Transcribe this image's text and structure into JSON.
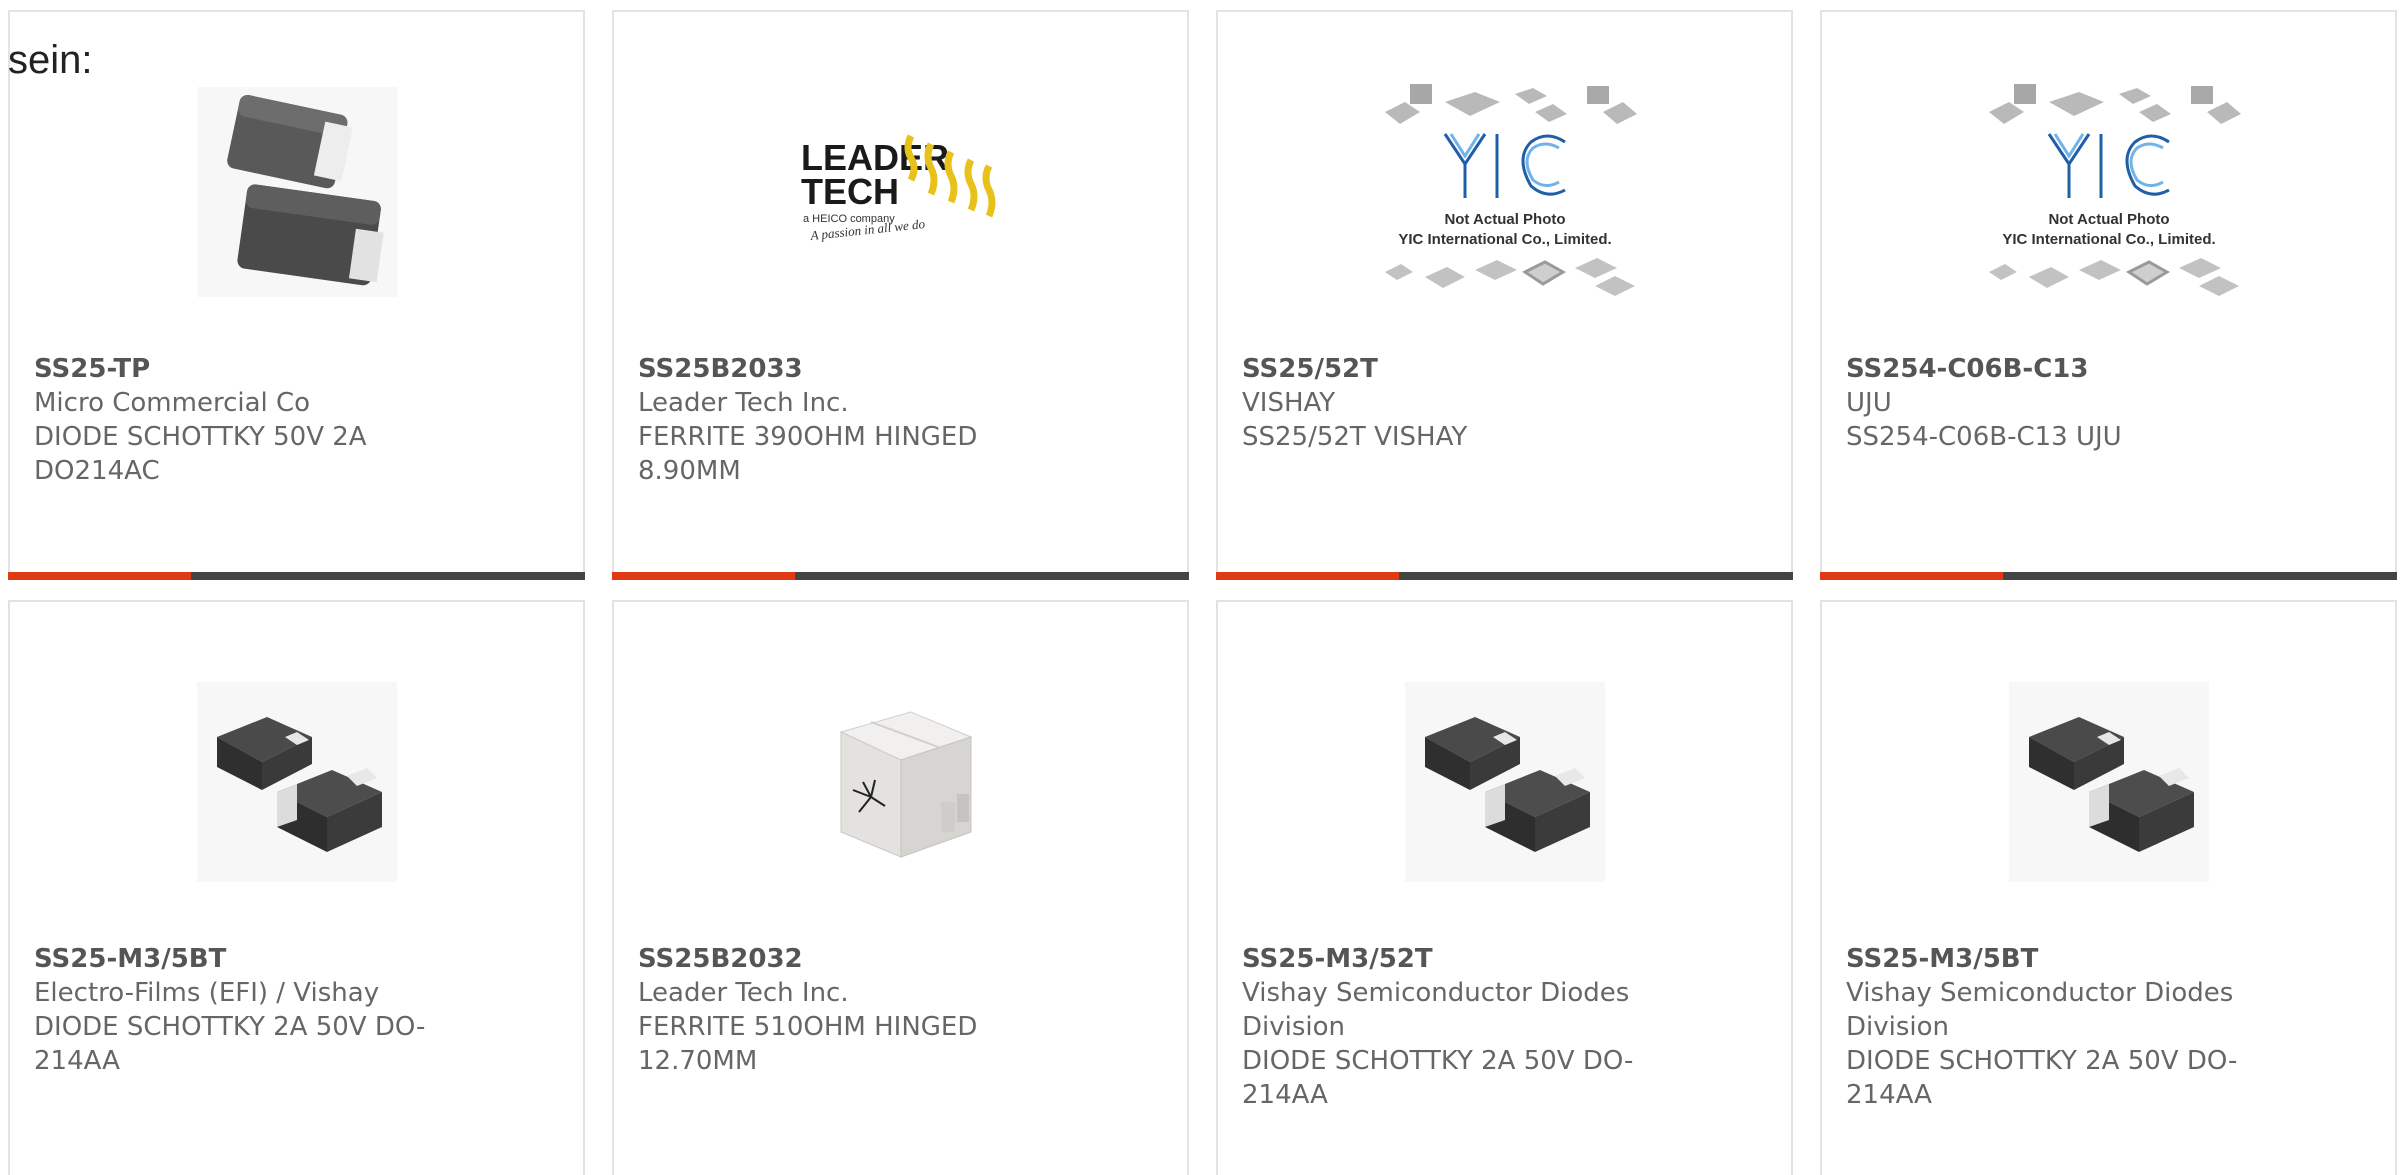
{
  "page": {
    "heading": "sein:"
  },
  "colors": {
    "accent": "#e03a12",
    "bar": "#444444",
    "border": "#e3e3e3",
    "text": "#666666"
  },
  "products": [
    {
      "part": "SS25-TP",
      "manufacturer": "Micro Commercial Co",
      "description": "DIODE SCHOTTKY 50V 2A DO214AC",
      "image": "smd-diode-do214-photo"
    },
    {
      "part": "SS25B2033",
      "manufacturer": "Leader Tech Inc.",
      "description": "FERRITE 390OHM HINGED 8.90MM",
      "image": "leader-tech-logo",
      "logo": {
        "line1": "LEADER",
        "line2": "TECH",
        "sub": "a HEICO company",
        "slogan": "A passion in all we do"
      }
    },
    {
      "part": "SS25/52T",
      "manufacturer": "VISHAY",
      "description": "SS25/52T VISHAY",
      "image": "yic-not-actual-photo",
      "placeholder": {
        "brand": "YIC",
        "line1": "Not Actual Photo",
        "line2": "YIC International Co., Limited."
      }
    },
    {
      "part": "SS254-C06B-C13",
      "manufacturer": "UJU",
      "description": "SS254-C06B-C13 UJU",
      "image": "yic-not-actual-photo",
      "placeholder": {
        "brand": "YIC",
        "line1": "Not Actual Photo",
        "line2": "YIC International Co., Limited."
      }
    },
    {
      "part": "SS25-M3/5BT",
      "manufacturer": "Electro-Films (EFI) / Vishay",
      "description": "DIODE SCHOTTKY 2A 50V DO-214AA",
      "image": "smd-diode-do214aa-photo"
    },
    {
      "part": "SS25B2032",
      "manufacturer": "Leader Tech Inc.",
      "description": "FERRITE 510OHM HINGED 12.70MM",
      "image": "ferrite-core-photo"
    },
    {
      "part": "SS25-M3/52T",
      "manufacturer": "Vishay Semiconductor Diodes Division",
      "description": "DIODE SCHOTTKY 2A 50V DO-214AA",
      "image": "smd-diode-do214aa-photo"
    },
    {
      "part": "SS25-M3/5BT",
      "manufacturer": "Vishay Semiconductor Diodes Division",
      "description": "DIODE SCHOTTKY 2A 50V DO-214AA",
      "image": "smd-diode-do214aa-photo"
    }
  ]
}
